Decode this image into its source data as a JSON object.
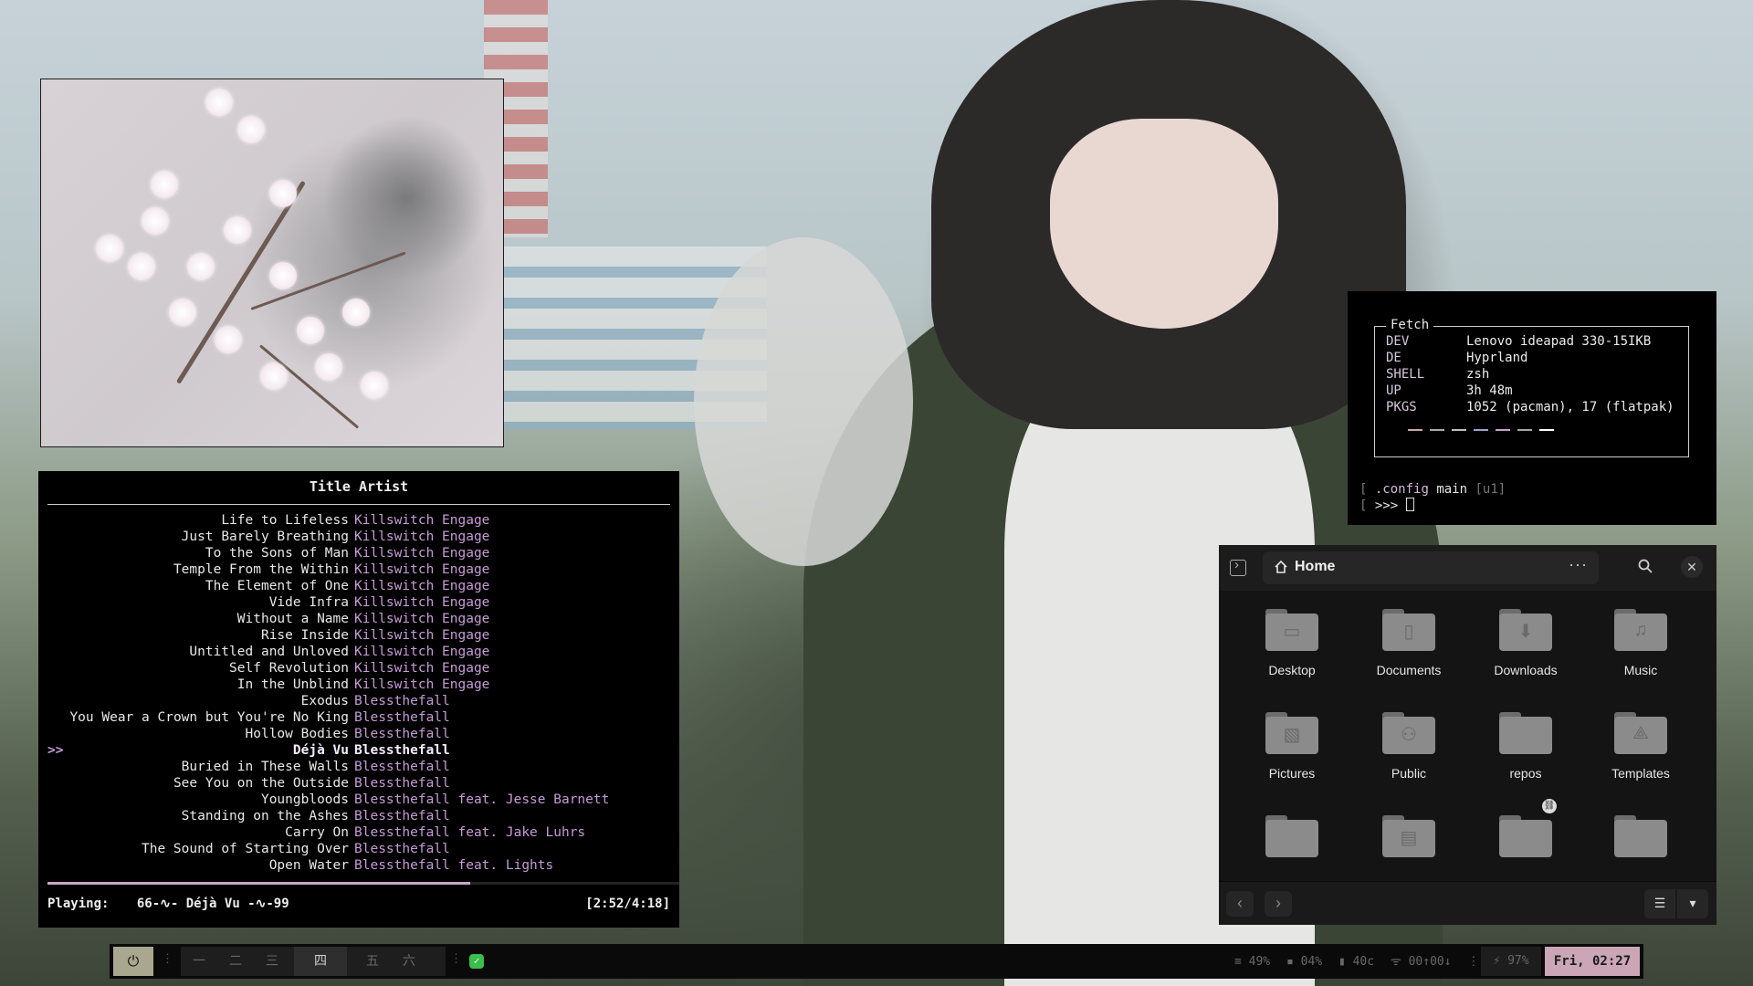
{
  "player": {
    "header": "Title Artist",
    "tracks": [
      {
        "title": "Life to Lifeless",
        "artist": "Killswitch Engage"
      },
      {
        "title": "Just Barely Breathing",
        "artist": "Killswitch Engage"
      },
      {
        "title": "To the Sons of Man",
        "artist": "Killswitch Engage"
      },
      {
        "title": "Temple From the Within",
        "artist": "Killswitch Engage"
      },
      {
        "title": "The Element of One",
        "artist": "Killswitch Engage"
      },
      {
        "title": "Vide Infra",
        "artist": "Killswitch Engage"
      },
      {
        "title": "Without a Name",
        "artist": "Killswitch Engage"
      },
      {
        "title": "Rise Inside",
        "artist": "Killswitch Engage"
      },
      {
        "title": "Untitled and Unloved",
        "artist": "Killswitch Engage"
      },
      {
        "title": "Self Revolution",
        "artist": "Killswitch Engage"
      },
      {
        "title": "In the Unblind",
        "artist": "Killswitch Engage"
      },
      {
        "title": "Exodus",
        "artist": "Blessthefall"
      },
      {
        "title": "You Wear a Crown but You're No King",
        "artist": "Blessthefall"
      },
      {
        "title": "Hollow Bodies",
        "artist": "Blessthefall"
      },
      {
        "title": "Déjà Vu",
        "artist": "Blessthefall"
      },
      {
        "title": "Buried in These Walls",
        "artist": "Blessthefall"
      },
      {
        "title": "See You on the Outside",
        "artist": "Blessthefall"
      },
      {
        "title": "Youngbloods",
        "artist": "Blessthefall feat. Jesse Barnett"
      },
      {
        "title": "Standing on the Ashes",
        "artist": "Blessthefall"
      },
      {
        "title": "Carry On",
        "artist": "Blessthefall feat. Jake Luhrs"
      },
      {
        "title": "The Sound of Starting Over",
        "artist": "Blessthefall"
      },
      {
        "title": "Open Water",
        "artist": "Blessthefall feat. Lights"
      }
    ],
    "current_index": 14,
    "current_marker": ">>",
    "progress_fraction": 0.669,
    "playing_label": "Playing:",
    "playing_text": "66-∿- Déjà Vu -∿-99",
    "time": "[2:52/4:18]"
  },
  "fetch": {
    "title": "Fetch",
    "rows": [
      {
        "key": "DEV",
        "value": "Lenovo ideapad 330-15IKB"
      },
      {
        "key": "DE",
        "value": "Hyprland"
      },
      {
        "key": "SHELL",
        "value": "zsh"
      },
      {
        "key": "UP",
        "value": "3h 48m"
      },
      {
        "key": "PKGS",
        "value": "1052 (pacman), 17 (flatpak)"
      }
    ],
    "swatch_colors": [
      "#c9a6a6",
      "#a9a9a9",
      "#bdbdbd",
      "#9fa3c9",
      "#c4a3cc",
      "#a6a6a6",
      "#ffffff"
    ],
    "prompt_dir": ".config",
    "branch_icon": "",
    "branch": "main",
    "branch_status": "[u1]",
    "prompt_symbol": ">>>"
  },
  "files": {
    "location": "Home",
    "more": "···",
    "close": "✕",
    "items": [
      {
        "name": "Desktop",
        "icon": "monitor-icon",
        "glyph": "▭"
      },
      {
        "name": "Documents",
        "icon": "document-icon",
        "glyph": "▯"
      },
      {
        "name": "Downloads",
        "icon": "download-icon",
        "glyph": "⬇"
      },
      {
        "name": "Music",
        "icon": "music-note-icon",
        "glyph": "♫"
      },
      {
        "name": "Pictures",
        "icon": "image-icon",
        "glyph": "▧"
      },
      {
        "name": "Public",
        "icon": "people-icon",
        "glyph": "⚇"
      },
      {
        "name": "repos",
        "icon": "folder-icon",
        "glyph": ""
      },
      {
        "name": "Templates",
        "icon": "template-icon",
        "glyph": "⟁"
      },
      {
        "name": "",
        "icon": "folder-icon",
        "glyph": ""
      },
      {
        "name": "",
        "icon": "video-icon",
        "glyph": "▤"
      },
      {
        "name": "",
        "icon": "folder-icon",
        "glyph": "",
        "link": true
      },
      {
        "name": "",
        "icon": "folder-icon",
        "glyph": ""
      }
    ],
    "back": "‹",
    "forward": "›",
    "view_list": "☰",
    "view_menu": "▾"
  },
  "bar": {
    "power": "⏻",
    "workspaces": [
      "一",
      "二",
      "三",
      "四",
      "五",
      "六"
    ],
    "active_workspace": 3,
    "check": "✓",
    "stats": [
      "≡ 49%",
      "▪ 04%",
      "▮ 40c",
      "ᯤ 00↑00↓"
    ],
    "battery": "97%",
    "clock": "Fri, 02:27"
  }
}
